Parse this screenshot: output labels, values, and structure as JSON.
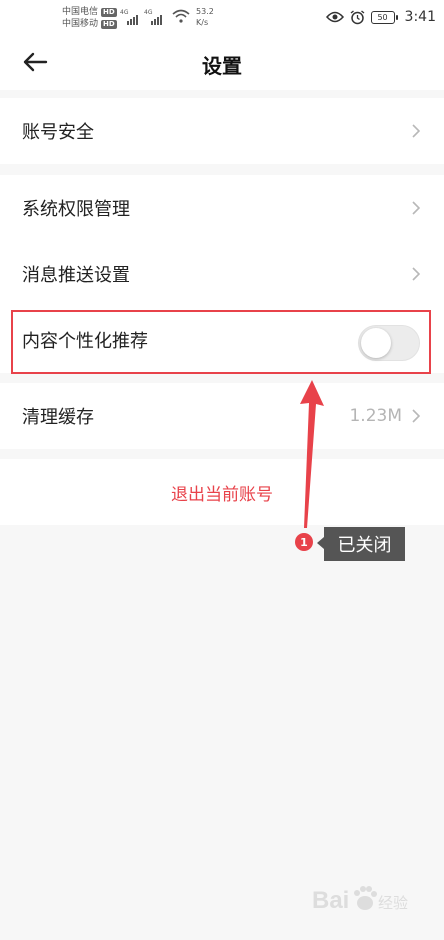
{
  "status_bar": {
    "carrier1": "中国电信",
    "carrier2": "中国移动",
    "hd": "HD",
    "sig_tag": "4G",
    "speed_value": "53.2",
    "speed_unit": "K/s",
    "battery": "50",
    "time": "3:41"
  },
  "header": {
    "title": "设置"
  },
  "settings": {
    "account_security": "账号安全",
    "system_permissions": "系统权限管理",
    "push_settings": "消息推送设置",
    "personalized_recommend": "内容个性化推荐",
    "clear_cache": "清理缓存",
    "cache_size": "1.23M",
    "logout": "退出当前账号"
  },
  "annotation": {
    "number": "1",
    "label": "已关闭"
  },
  "watermark": {
    "text": "Bai 经验"
  },
  "colors": {
    "accent_red": "#e8424a",
    "annotation_bg": "#555555",
    "background": "#f7f7f7"
  }
}
